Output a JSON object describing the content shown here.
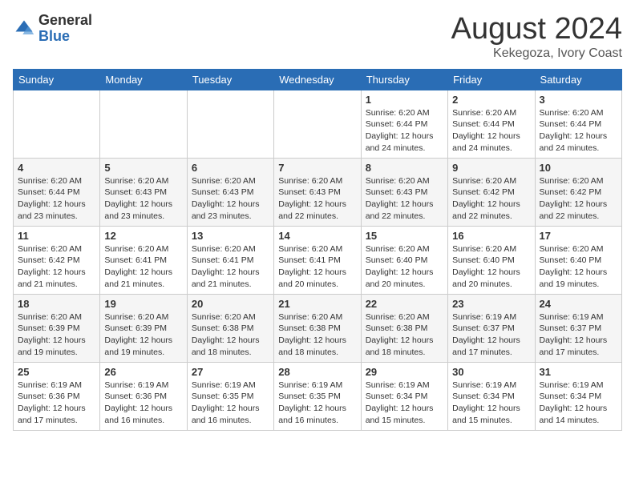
{
  "header": {
    "logo_general": "General",
    "logo_blue": "Blue",
    "title": "August 2024",
    "subtitle": "Kekegoza, Ivory Coast"
  },
  "weekdays": [
    "Sunday",
    "Monday",
    "Tuesday",
    "Wednesday",
    "Thursday",
    "Friday",
    "Saturday"
  ],
  "weeks": [
    [
      {
        "day": "",
        "details": ""
      },
      {
        "day": "",
        "details": ""
      },
      {
        "day": "",
        "details": ""
      },
      {
        "day": "",
        "details": ""
      },
      {
        "day": "1",
        "details": "Sunrise: 6:20 AM\nSunset: 6:44 PM\nDaylight: 12 hours\nand 24 minutes."
      },
      {
        "day": "2",
        "details": "Sunrise: 6:20 AM\nSunset: 6:44 PM\nDaylight: 12 hours\nand 24 minutes."
      },
      {
        "day": "3",
        "details": "Sunrise: 6:20 AM\nSunset: 6:44 PM\nDaylight: 12 hours\nand 24 minutes."
      }
    ],
    [
      {
        "day": "4",
        "details": "Sunrise: 6:20 AM\nSunset: 6:44 PM\nDaylight: 12 hours\nand 23 minutes."
      },
      {
        "day": "5",
        "details": "Sunrise: 6:20 AM\nSunset: 6:43 PM\nDaylight: 12 hours\nand 23 minutes."
      },
      {
        "day": "6",
        "details": "Sunrise: 6:20 AM\nSunset: 6:43 PM\nDaylight: 12 hours\nand 23 minutes."
      },
      {
        "day": "7",
        "details": "Sunrise: 6:20 AM\nSunset: 6:43 PM\nDaylight: 12 hours\nand 22 minutes."
      },
      {
        "day": "8",
        "details": "Sunrise: 6:20 AM\nSunset: 6:43 PM\nDaylight: 12 hours\nand 22 minutes."
      },
      {
        "day": "9",
        "details": "Sunrise: 6:20 AM\nSunset: 6:42 PM\nDaylight: 12 hours\nand 22 minutes."
      },
      {
        "day": "10",
        "details": "Sunrise: 6:20 AM\nSunset: 6:42 PM\nDaylight: 12 hours\nand 22 minutes."
      }
    ],
    [
      {
        "day": "11",
        "details": "Sunrise: 6:20 AM\nSunset: 6:42 PM\nDaylight: 12 hours\nand 21 minutes."
      },
      {
        "day": "12",
        "details": "Sunrise: 6:20 AM\nSunset: 6:41 PM\nDaylight: 12 hours\nand 21 minutes."
      },
      {
        "day": "13",
        "details": "Sunrise: 6:20 AM\nSunset: 6:41 PM\nDaylight: 12 hours\nand 21 minutes."
      },
      {
        "day": "14",
        "details": "Sunrise: 6:20 AM\nSunset: 6:41 PM\nDaylight: 12 hours\nand 20 minutes."
      },
      {
        "day": "15",
        "details": "Sunrise: 6:20 AM\nSunset: 6:40 PM\nDaylight: 12 hours\nand 20 minutes."
      },
      {
        "day": "16",
        "details": "Sunrise: 6:20 AM\nSunset: 6:40 PM\nDaylight: 12 hours\nand 20 minutes."
      },
      {
        "day": "17",
        "details": "Sunrise: 6:20 AM\nSunset: 6:40 PM\nDaylight: 12 hours\nand 19 minutes."
      }
    ],
    [
      {
        "day": "18",
        "details": "Sunrise: 6:20 AM\nSunset: 6:39 PM\nDaylight: 12 hours\nand 19 minutes."
      },
      {
        "day": "19",
        "details": "Sunrise: 6:20 AM\nSunset: 6:39 PM\nDaylight: 12 hours\nand 19 minutes."
      },
      {
        "day": "20",
        "details": "Sunrise: 6:20 AM\nSunset: 6:38 PM\nDaylight: 12 hours\nand 18 minutes."
      },
      {
        "day": "21",
        "details": "Sunrise: 6:20 AM\nSunset: 6:38 PM\nDaylight: 12 hours\nand 18 minutes."
      },
      {
        "day": "22",
        "details": "Sunrise: 6:20 AM\nSunset: 6:38 PM\nDaylight: 12 hours\nand 18 minutes."
      },
      {
        "day": "23",
        "details": "Sunrise: 6:19 AM\nSunset: 6:37 PM\nDaylight: 12 hours\nand 17 minutes."
      },
      {
        "day": "24",
        "details": "Sunrise: 6:19 AM\nSunset: 6:37 PM\nDaylight: 12 hours\nand 17 minutes."
      }
    ],
    [
      {
        "day": "25",
        "details": "Sunrise: 6:19 AM\nSunset: 6:36 PM\nDaylight: 12 hours\nand 17 minutes."
      },
      {
        "day": "26",
        "details": "Sunrise: 6:19 AM\nSunset: 6:36 PM\nDaylight: 12 hours\nand 16 minutes."
      },
      {
        "day": "27",
        "details": "Sunrise: 6:19 AM\nSunset: 6:35 PM\nDaylight: 12 hours\nand 16 minutes."
      },
      {
        "day": "28",
        "details": "Sunrise: 6:19 AM\nSunset: 6:35 PM\nDaylight: 12 hours\nand 16 minutes."
      },
      {
        "day": "29",
        "details": "Sunrise: 6:19 AM\nSunset: 6:34 PM\nDaylight: 12 hours\nand 15 minutes."
      },
      {
        "day": "30",
        "details": "Sunrise: 6:19 AM\nSunset: 6:34 PM\nDaylight: 12 hours\nand 15 minutes."
      },
      {
        "day": "31",
        "details": "Sunrise: 6:19 AM\nSunset: 6:34 PM\nDaylight: 12 hours\nand 14 minutes."
      }
    ]
  ]
}
